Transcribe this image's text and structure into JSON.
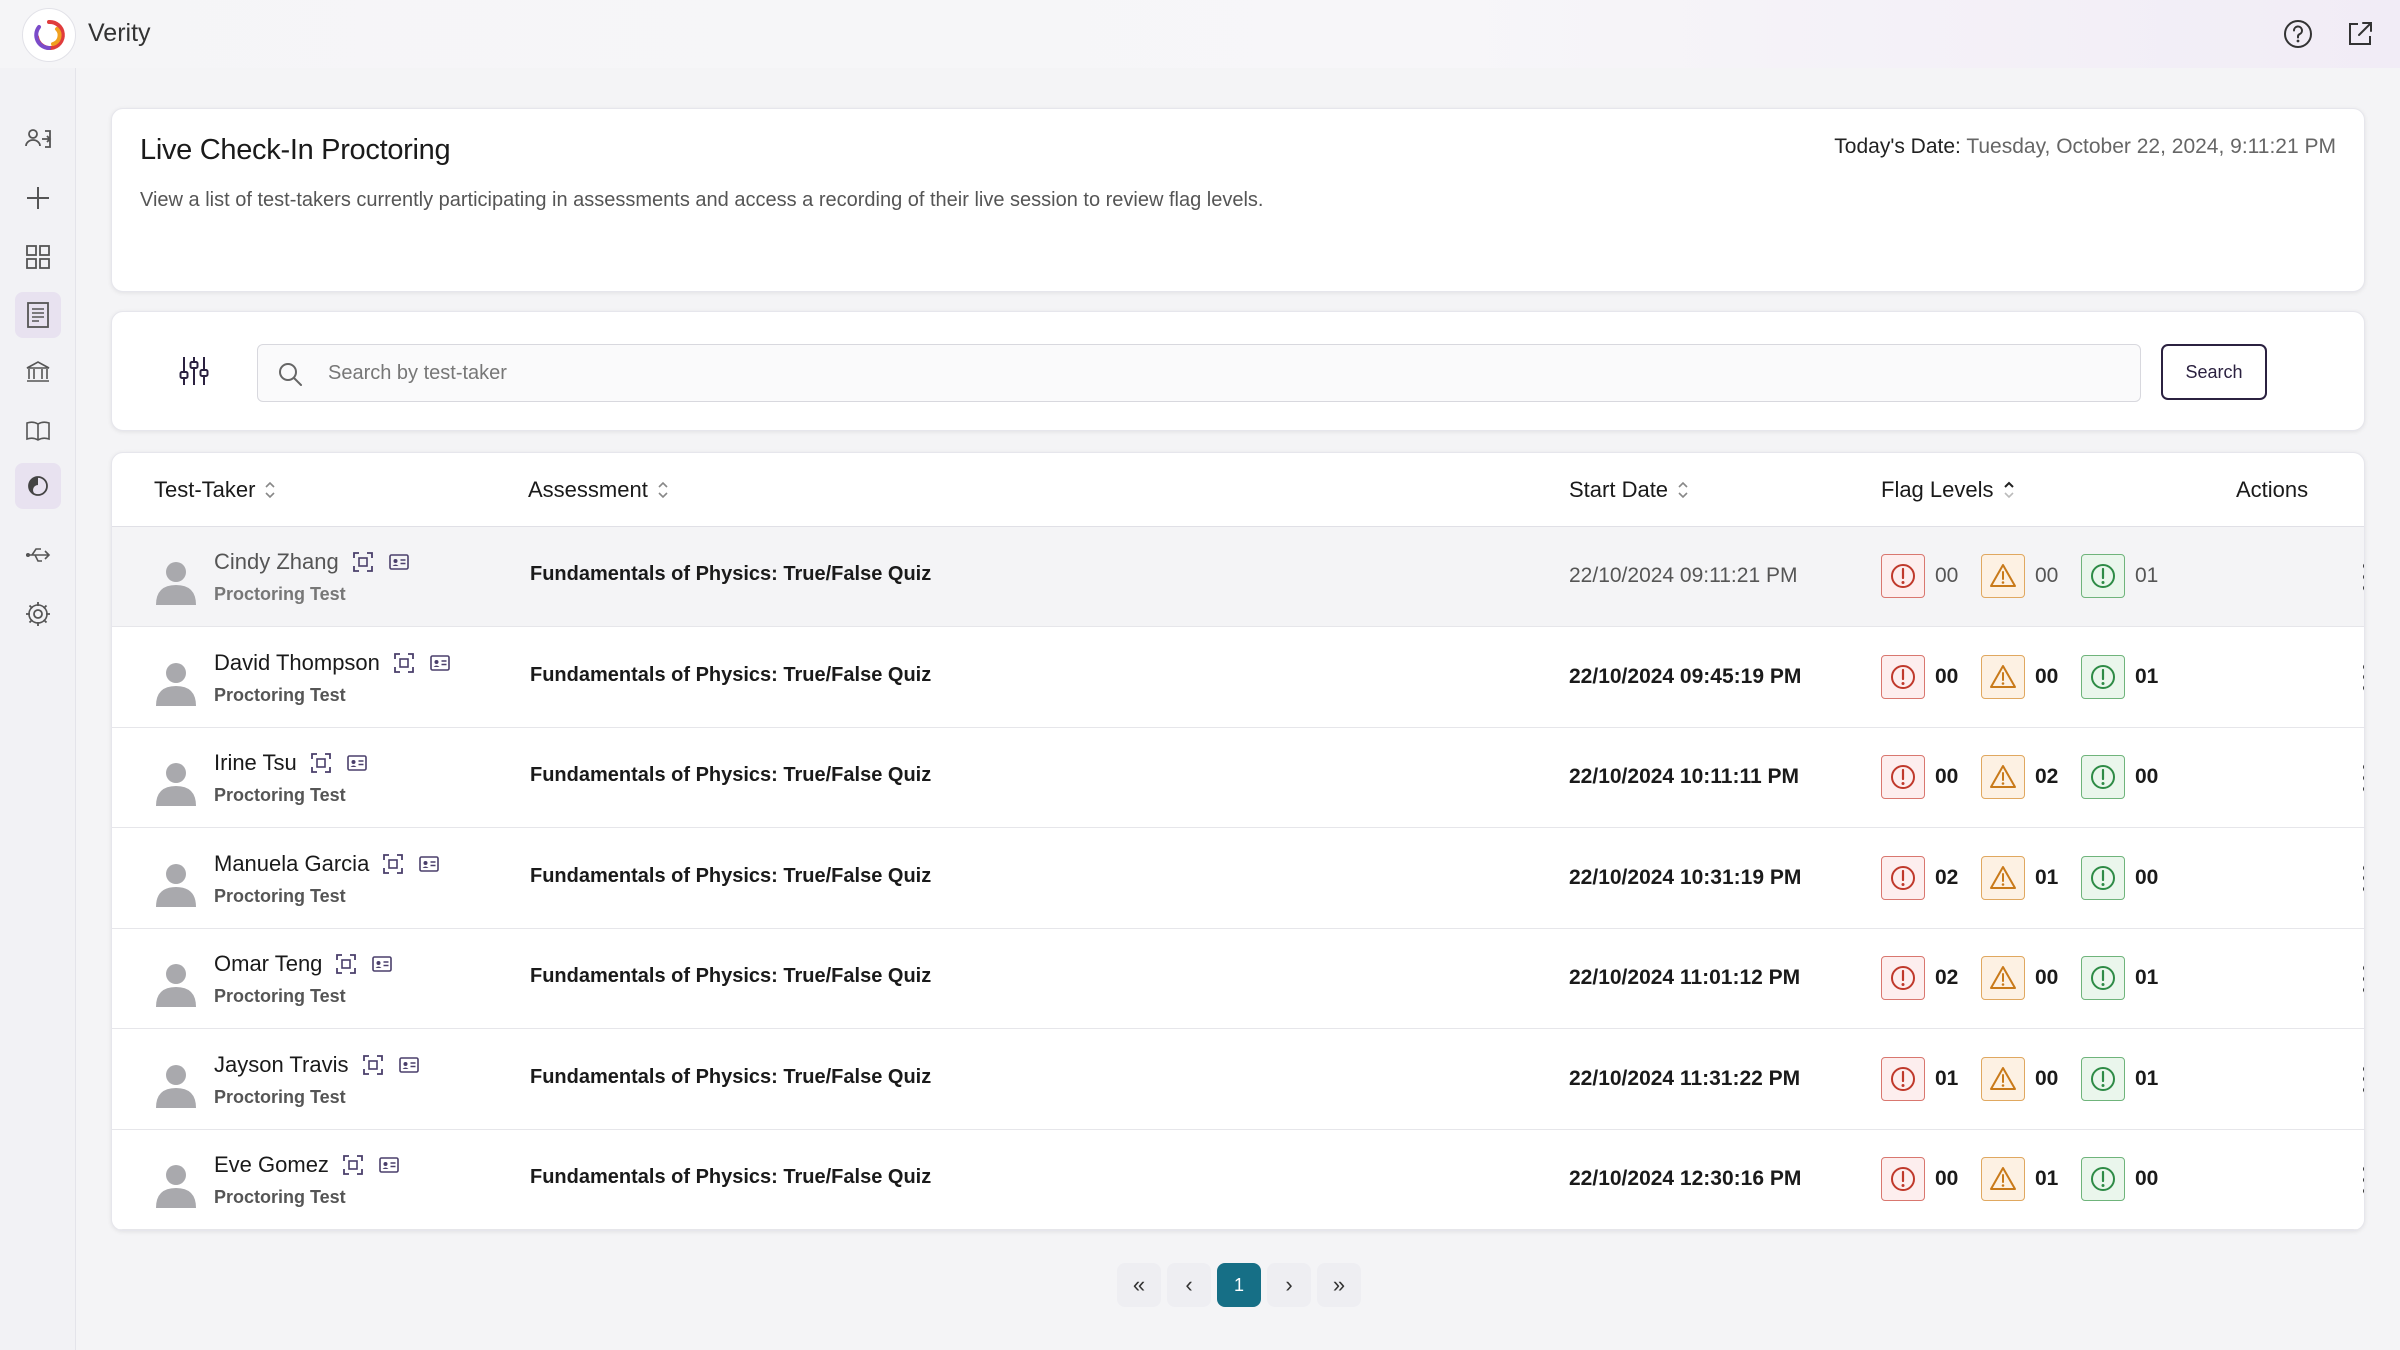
{
  "app": {
    "name": "Verity"
  },
  "topbar": {
    "help_icon": "help-icon",
    "external_icon": "external-link-icon"
  },
  "sidebar": {
    "items": [
      {
        "icon": "user-login-icon",
        "active": false
      },
      {
        "icon": "plus-icon",
        "active": false
      },
      {
        "icon": "grid-icon",
        "active": false
      },
      {
        "icon": "report-icon",
        "active": false
      },
      {
        "icon": "institution-icon",
        "active": false
      },
      {
        "icon": "book-icon",
        "active": false
      },
      {
        "icon": "proctoring-icon",
        "active": true
      },
      {
        "icon": "usb-icon",
        "active": false
      },
      {
        "icon": "gear-icon",
        "active": false
      }
    ]
  },
  "header": {
    "title": "Live Check-In Proctoring",
    "date_label": "Today's Date:",
    "date_value": "Tuesday, October 22, 2024, 9:11:21 PM",
    "description": "View a list of test-takers currently participating in assessments and access a recording of their live session to review flag levels."
  },
  "search": {
    "placeholder": "Search by test-taker",
    "value": "",
    "button_label": "Search"
  },
  "table": {
    "columns": [
      "Test-Taker",
      "Assessment",
      "Start Date",
      "Flag Levels",
      "Actions"
    ],
    "rows": [
      {
        "name": "Cindy Zhang",
        "sub": "Proctoring Test",
        "assessment": "Fundamentals of Physics: True/False Quiz",
        "start": "22/10/2024 09:11:21 PM",
        "red": "00",
        "orange": "00",
        "green": "01"
      },
      {
        "name": "David Thompson",
        "sub": "Proctoring Test",
        "assessment": "Fundamentals of Physics: True/False Quiz",
        "start": "22/10/2024 09:45:19 PM",
        "red": "00",
        "orange": "00",
        "green": "01"
      },
      {
        "name": "Irine Tsu",
        "sub": "Proctoring Test",
        "assessment": "Fundamentals of Physics: True/False Quiz",
        "start": "22/10/2024 10:11:11 PM",
        "red": "00",
        "orange": "02",
        "green": "00"
      },
      {
        "name": "Manuela Garcia",
        "sub": "Proctoring Test",
        "assessment": "Fundamentals of Physics: True/False Quiz",
        "start": "22/10/2024 10:31:19 PM",
        "red": "02",
        "orange": "01",
        "green": "00"
      },
      {
        "name": "Omar Teng",
        "sub": "Proctoring Test",
        "assessment": "Fundamentals of Physics: True/False Quiz",
        "start": "22/10/2024 11:01:12 PM",
        "red": "02",
        "orange": "00",
        "green": "01"
      },
      {
        "name": "Jayson Travis",
        "sub": "Proctoring Test",
        "assessment": "Fundamentals of Physics: True/False Quiz",
        "start": "22/10/2024 11:31:22 PM",
        "red": "01",
        "orange": "00",
        "green": "01"
      },
      {
        "name": "Eve Gomez",
        "sub": "Proctoring Test",
        "assessment": "Fundamentals of Physics: True/False Quiz",
        "start": "22/10/2024 12:30:16 PM",
        "red": "00",
        "orange": "01",
        "green": "00"
      }
    ]
  },
  "pagination": {
    "first": "«",
    "prev": "‹",
    "current": "1",
    "next": "›",
    "last": "»"
  },
  "colors": {
    "accent": "#166f86",
    "flag_red": "#c0392b",
    "flag_orange": "#c97a1a",
    "flag_green": "#2e8b46"
  }
}
